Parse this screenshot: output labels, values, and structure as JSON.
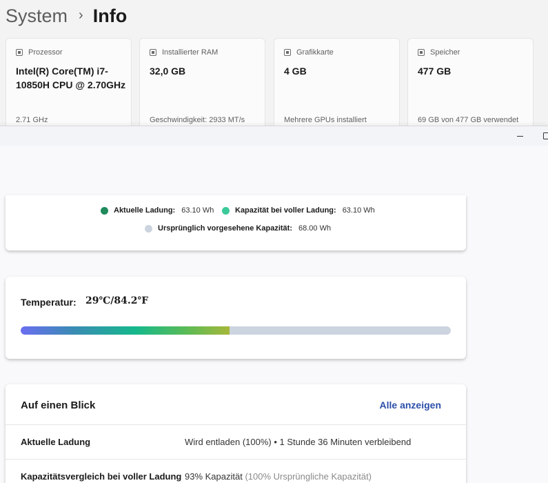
{
  "breadcrumb": {
    "parent": "System",
    "separator": "›",
    "current": "Info"
  },
  "specs": [
    {
      "icon": "processor-icon",
      "label": "Prozessor",
      "value": "Intel(R) Core(TM) i7-10850H CPU @ 2.70GHz",
      "sub": "2.71 GHz"
    },
    {
      "icon": "ram-icon",
      "label": "Installierter RAM",
      "value": "32,0 GB",
      "sub": "Geschwindigkeit: 2933 MT/s"
    },
    {
      "icon": "graphics-card-icon",
      "label": "Grafikkarte",
      "value": "4 GB",
      "sub": "Mehrere GPUs installiert"
    },
    {
      "icon": "storage-icon",
      "label": "Speicher",
      "value": "477 GB",
      "sub": "69 GB von 477 GB verwendet"
    }
  ],
  "battery": {
    "legend": [
      {
        "label": "Aktuelle Ladung:",
        "value": "63.10 Wh",
        "color": "#1f8a5b"
      },
      {
        "label": "Kapazität bei voller Ladung:",
        "value": "63.10 Wh",
        "color": "#3cc99a"
      },
      {
        "label": "Ursprünglich vorgesehene Kapazität:",
        "value": "68.00 Wh",
        "color": "#cbd4df"
      }
    ],
    "temperature": {
      "label": "Temperatur:",
      "value": "29℃/84.2℉",
      "level": 0.485
    },
    "glance": {
      "title": "Auf einen Blick",
      "link": "Alle anzeigen",
      "rows": [
        {
          "key": "Aktuelle Ladung",
          "value": "Wird entladen (100%) • 1 Stunde 36 Minuten verbleibend",
          "muted": ""
        },
        {
          "key": "Kapazitätsvergleich bei voller Ladung",
          "value": "93% Kapazität",
          "muted": "(100% Ursprüngliche Kapazität)"
        }
      ]
    }
  }
}
